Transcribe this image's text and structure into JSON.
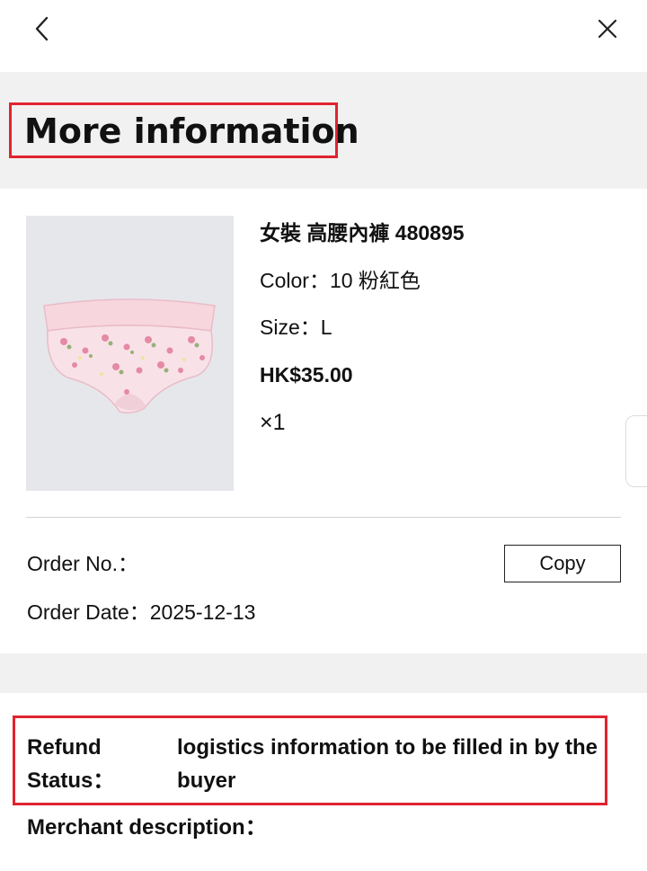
{
  "nav": {
    "back_icon": "chevron-left-icon",
    "close_icon": "close-icon"
  },
  "page": {
    "title": "More information"
  },
  "product": {
    "name": "女裝 高腰內褲 480895",
    "color": "Color：10 粉紅色",
    "size": "Size：L",
    "price": "HK$35.00",
    "quantity": "×1",
    "image_icon": "pink-floral-briefs-image"
  },
  "order": {
    "number_label": "Order No.：",
    "date": "Order Date：2025-12-13",
    "copy_label": "Copy"
  },
  "refund": {
    "status_label": "Refund Status：",
    "status_value": "logistics information to be filled in by the buyer"
  },
  "merchant": {
    "description_label": "Merchant description："
  },
  "colors": {
    "highlight_border": "#e0242f",
    "band_background": "#f1f1f1",
    "image_background": "#e6e7eb",
    "text": "#111111"
  }
}
